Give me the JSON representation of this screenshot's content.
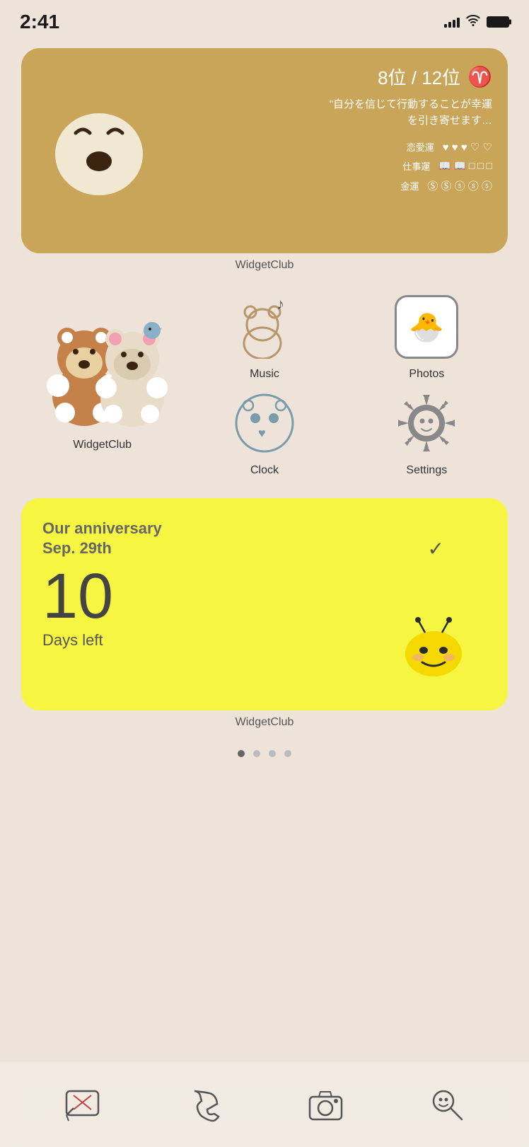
{
  "statusBar": {
    "time": "2:41",
    "signal": "4 bars",
    "wifi": true,
    "battery": "full"
  },
  "widget1": {
    "label": "WidgetClub",
    "rank": "8位 / 12位",
    "symbol": "♈",
    "quote": "\"自分を信じて行動することが幸運を引き寄せます…",
    "stats": {
      "love_label": "恋愛運",
      "love_filled": 3,
      "love_empty": 2,
      "work_label": "仕事運",
      "work_filled": 2,
      "work_empty": 3,
      "money_label": "金運",
      "money_filled": 2,
      "money_empty": 3
    }
  },
  "apps": [
    {
      "id": "music",
      "label": "Music"
    },
    {
      "id": "photos",
      "label": "Photos"
    },
    {
      "id": "widgetclub-bears",
      "label": "WidgetClub"
    },
    {
      "id": "clock",
      "label": "Clock"
    },
    {
      "id": "settings",
      "label": "Settings"
    },
    {
      "id": "",
      "label": ""
    }
  ],
  "widget2": {
    "label": "WidgetClub",
    "title_line1": "Our anniversary",
    "title_line2": "Sep. 29th",
    "days_number": "10",
    "days_label": "Days left"
  },
  "pageDots": {
    "total": 4,
    "active": 0
  },
  "dock": {
    "items": [
      {
        "id": "messages",
        "label": "Messages"
      },
      {
        "id": "phone",
        "label": "Phone"
      },
      {
        "id": "camera",
        "label": "Camera"
      },
      {
        "id": "search",
        "label": "Search"
      }
    ]
  }
}
